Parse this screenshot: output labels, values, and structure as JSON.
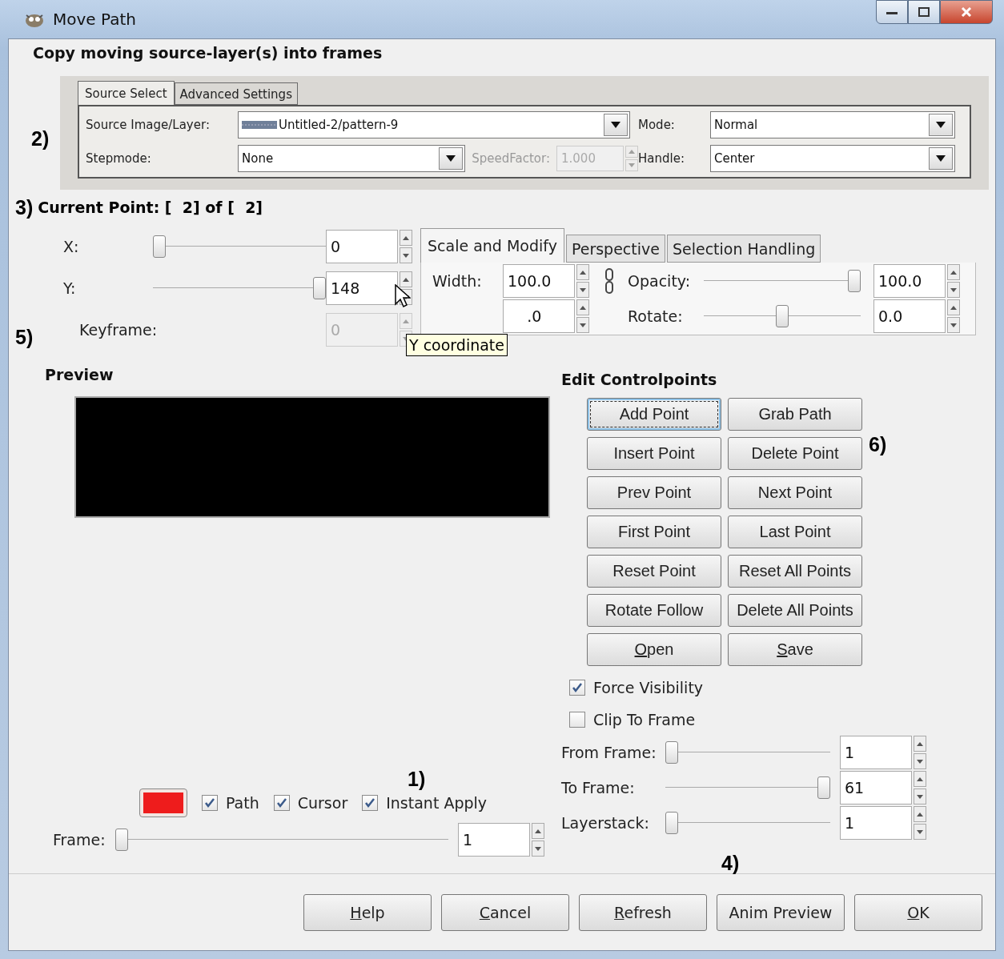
{
  "window": {
    "title": "Move Path"
  },
  "heading": "Copy moving source-layer(s) into frames",
  "source_select": {
    "annotation": "2)",
    "tabs": [
      {
        "label": "Source Select",
        "selected": true
      },
      {
        "label": "Advanced Settings",
        "selected": false
      }
    ],
    "source_layer": {
      "label": "Source Image/Layer:",
      "value": "Untitled-2/pattern-9"
    },
    "mode": {
      "label": "Mode:",
      "value": "Normal"
    },
    "stepmode": {
      "label": "Stepmode:",
      "value": "None"
    },
    "speed_factor": {
      "label": "SpeedFactor:",
      "value": "1.000",
      "disabled": true
    },
    "handle": {
      "label": "Handle:",
      "value": "Center"
    }
  },
  "current_point": {
    "annotation": "3)",
    "text": "Current Point: [  2] of [  2]"
  },
  "coords": {
    "annotation": "5)",
    "rows": [
      {
        "kind": "slider",
        "label": "X:",
        "value": "0",
        "level": 0,
        "disabled": false
      },
      {
        "kind": "slider",
        "label": "Y:",
        "value": "148",
        "level": 1,
        "disabled": false
      },
      {
        "kind": "plain",
        "label": "Keyframe:",
        "value": "0",
        "disabled": true
      }
    ]
  },
  "transform": {
    "tabs": [
      {
        "label": "Scale and Modify",
        "selected": true
      },
      {
        "label": "Perspective",
        "selected": false
      },
      {
        "label": "Selection Handling",
        "selected": false
      }
    ],
    "width": {
      "label": "Width:",
      "value": "100.0"
    },
    "height": {
      "value": ".0"
    },
    "opacity": {
      "label": "Opacity:",
      "value": "100.0",
      "level": 1
    },
    "rotate": {
      "label": "Rotate:",
      "value": "0.0",
      "level": 0.5
    }
  },
  "tooltip": "Y coordinate",
  "preview": {
    "label": "Preview"
  },
  "controlpoints": {
    "title": "Edit Controlpoints",
    "annotation": "6)",
    "buttons": [
      {
        "label": "Add Point",
        "focused": true
      },
      {
        "label": "Grab Path",
        "focused": false
      },
      {
        "label": "Insert Point",
        "focused": false
      },
      {
        "label": "Delete Point",
        "focused": false
      },
      {
        "label": "Prev Point",
        "focused": false
      },
      {
        "label": "Next Point",
        "focused": false
      },
      {
        "label": "First Point",
        "focused": false
      },
      {
        "label": "Last Point",
        "focused": false
      },
      {
        "label": "Reset Point",
        "focused": false
      },
      {
        "label": "Reset All Points",
        "focused": false
      },
      {
        "label": "Rotate Follow",
        "focused": false
      },
      {
        "label": "Delete All Points",
        "focused": false
      },
      {
        "mnemonic": "O",
        "rest": "pen",
        "focused": false
      },
      {
        "mnemonic": "S",
        "rest": "ave",
        "focused": false
      }
    ]
  },
  "options": [
    {
      "label": "Force Visibility",
      "checked": true
    },
    {
      "label": "Clip To Frame",
      "checked": false
    }
  ],
  "range": {
    "annotation": "4)",
    "rows": [
      {
        "label": "From Frame:",
        "value": "1",
        "level": 0
      },
      {
        "label": "To Frame:",
        "value": "61",
        "level": 1
      },
      {
        "label": "Layerstack:",
        "value": "1",
        "level": 0
      }
    ]
  },
  "display": {
    "annotation": "1)",
    "color": "#ee1c1c",
    "checks": [
      {
        "label": "Path",
        "checked": true
      },
      {
        "label": "Cursor",
        "checked": true
      },
      {
        "label": "Instant Apply",
        "checked": true
      }
    ],
    "frame": {
      "label": "Frame:",
      "value": "1",
      "level": 0
    }
  },
  "buttons": [
    {
      "mnemonic": "H",
      "rest": "elp"
    },
    {
      "mnemonic": "C",
      "rest": "ancel"
    },
    {
      "mnemonic": "R",
      "rest": "efresh"
    },
    {
      "label": "Anim Preview"
    },
    {
      "mnemonic": "O",
      "rest": "K"
    }
  ]
}
